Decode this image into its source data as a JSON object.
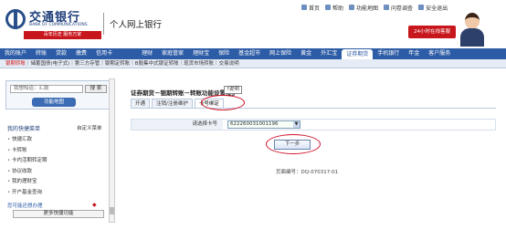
{
  "header": {
    "bank_name_cn": "交通银行",
    "bank_name_en": "BANK OF COMMUNICATIONS",
    "slogan": "百年历史 服务万家",
    "site_title": "个人网上银行",
    "hotline": "24小时在线客服",
    "top_links": [
      {
        "label": "首页",
        "icon": "home-icon"
      },
      {
        "label": "帮助",
        "icon": "help-icon"
      },
      {
        "label": "功能地图",
        "icon": "map-icon"
      },
      {
        "label": "问卷调查",
        "icon": "survey-icon"
      },
      {
        "label": "安全退出",
        "icon": "logout-icon"
      }
    ]
  },
  "nav": {
    "items": [
      "我的账户",
      "转账",
      "贷款",
      "缴费",
      "信用卡",
      "理财",
      "家庭管家",
      "理财宝",
      "保险",
      "基金超市",
      "网上保险",
      "黄金",
      "外汇宝",
      "证券期货",
      "手机银行",
      "年金",
      "客户服务"
    ],
    "active_index": 13
  },
  "subnav": {
    "active": "银期转账",
    "items": "｜储蓄国债(电子式)｜第三方存管｜银期定转账｜B股集中式银证转账｜现货市场转账｜交易说明"
  },
  "sidebar": {
    "search_placeholder": "我想知道：汇款",
    "search_button": "搜 索",
    "function_map_button": "功能地图",
    "quick_title": "我的快捷菜单",
    "custom_label": "自定义菜单",
    "quick_items": [
      "快捷汇款",
      "卡转账",
      "卡内活期转定期",
      "协议收款",
      "我的理财宝",
      "开户基金查询"
    ],
    "notice": "您可能还想办理",
    "more_button": "更多快捷功能"
  },
  "main": {
    "heading": "证券期货－银期转账－转账功能设置维护",
    "help_label": "说明",
    "tabs": [
      "开通",
      "注销/注册维护",
      "卡号绑定"
    ],
    "active_tab": 2,
    "form_label": "请选择卡号",
    "card_number": "622260031001196",
    "next_button": "下一步",
    "page_code": "页面编号：DQ-070317-01"
  },
  "colors": {
    "brand_blue": "#2d5ca6",
    "brand_red": "#c8161d",
    "annotation_red": "#d0142a"
  }
}
